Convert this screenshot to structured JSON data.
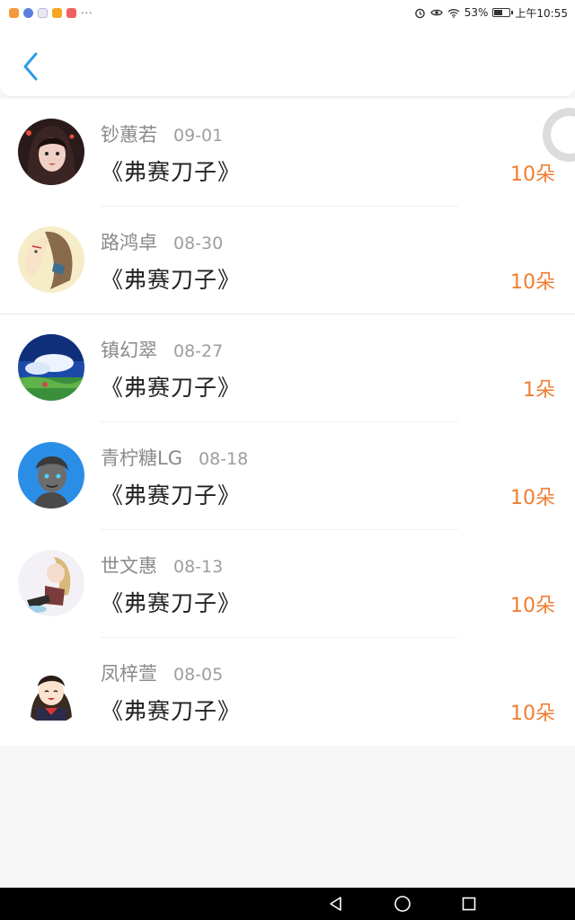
{
  "status_bar": {
    "battery": "53%",
    "time": "上午10:55",
    "more": "···"
  },
  "colors": {
    "accent": "#2e9ce6",
    "flower": "#f07d31"
  },
  "header": {
    "back_icon": "chevron-left-icon"
  },
  "entries": [
    {
      "name": "钞蕙若",
      "date": "09-01",
      "title": "《弗赛刀子》",
      "count": "10朵"
    },
    {
      "name": "路鸿卓",
      "date": "08-30",
      "title": "《弗赛刀子》",
      "count": "10朵"
    },
    {
      "name": "镇幻翠",
      "date": "08-27",
      "title": "《弗赛刀子》",
      "count": "1朵"
    },
    {
      "name": "青柠糖LG",
      "date": "08-18",
      "title": "《弗赛刀子》",
      "count": "10朵"
    },
    {
      "name": "世文惠",
      "date": "08-13",
      "title": "《弗赛刀子》",
      "count": "10朵"
    },
    {
      "name": "凤梓萱",
      "date": "08-05",
      "title": "《弗赛刀子》",
      "count": "10朵"
    }
  ],
  "nav": {
    "back": "triangle-back-icon",
    "home": "circle-home-icon",
    "recents": "square-recents-icon"
  }
}
